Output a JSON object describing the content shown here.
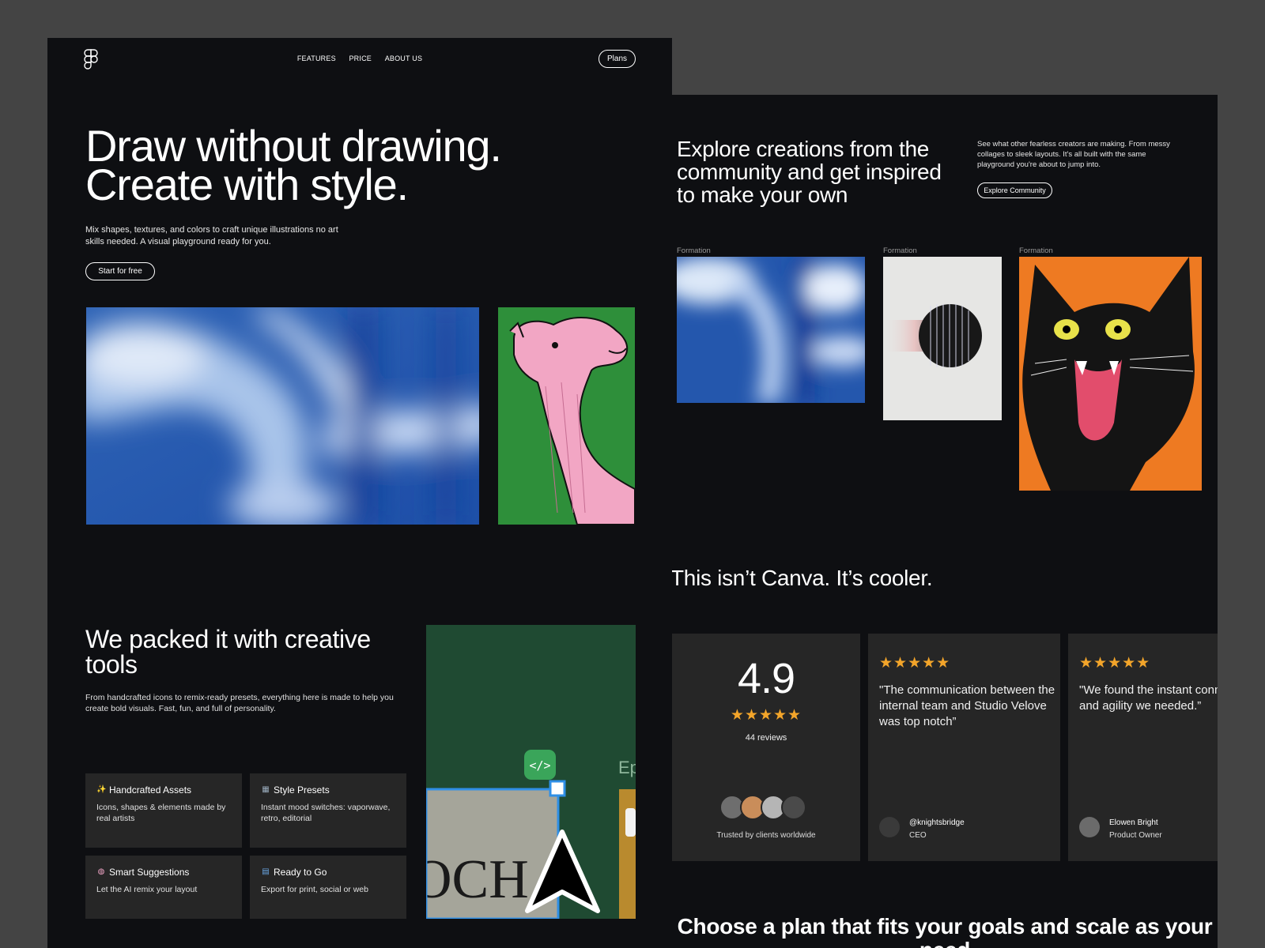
{
  "colors": {
    "page_bg": "#444444",
    "panel_bg": "#0e0f12",
    "card_bg": "#262626",
    "star": "#f3a52a",
    "demo_green": "#1f4a32",
    "selection_blue": "#2f8fe6"
  },
  "left": {
    "logo_icon": "figma-logo-icon",
    "nav": {
      "features": "FEATURES",
      "price": "PRICE",
      "about": "ABOUT US"
    },
    "plans_label": "Plans",
    "hero": {
      "title_line1": "Draw without drawing.",
      "title_line2": "Create with style.",
      "description": "Mix shapes, textures, and colors to craft unique illustrations no art skills needed. A visual playground ready for you.",
      "cta": "Start for free"
    },
    "packed": {
      "title": "We packed it with creative tools",
      "description": "From handcrafted icons to remix-ready presets, everything here is made to help you create bold visuals. Fast, fun, and full of personality."
    },
    "features": [
      {
        "icon": "sparkles-icon",
        "glyph": "✨",
        "title": "Handcrafted Assets",
        "desc": "Icons, shapes & elements made by real artists"
      },
      {
        "icon": "grid-icon",
        "glyph": "▦",
        "title": "Style Presets",
        "desc": "Instant mood switches: vaporwave, retro, editorial"
      },
      {
        "icon": "brain-icon",
        "glyph": "◍",
        "title": "Smart Suggestions",
        "desc": "Let the AI remix your layout"
      },
      {
        "icon": "inbox-tray-icon",
        "glyph": "▤",
        "title": "Ready to Go",
        "desc": "Export for print, social or web"
      }
    ],
    "demo": {
      "code_icon_text": "</>",
      "poster_text": "OCH",
      "edge_text": "Ep"
    }
  },
  "right": {
    "explore": {
      "title": "Explore creations from the community and get inspired to make your own",
      "description": "See what other fearless creators are making. From messy collages to sleek layouts. It's all built with the same playground you're about to jump into.",
      "cta": "Explore Community"
    },
    "gallery": [
      {
        "caption": "Formation"
      },
      {
        "caption": "Formation"
      },
      {
        "caption": "Formation"
      }
    ],
    "canva_title": "This isn’t Canva. It’s cooler.",
    "rating": {
      "value": "4.9",
      "stars": "★★★★★",
      "count": "44 reviews",
      "trusted": "Trusted by clients worldwide"
    },
    "reviews": [
      {
        "stars": "★★★★★",
        "quote": "\"The communication between the internal team and Studio Velove was top notch”",
        "name": "@knightsbridge",
        "role": "CEO"
      },
      {
        "stars": "★★★★★",
        "quote": "\"We found the instant connection and agility we needed.”",
        "name": "Elowen Bright",
        "role": "Product Owner"
      }
    ],
    "plan_title": "Choose a plan that fits your goals and scale as your need"
  }
}
